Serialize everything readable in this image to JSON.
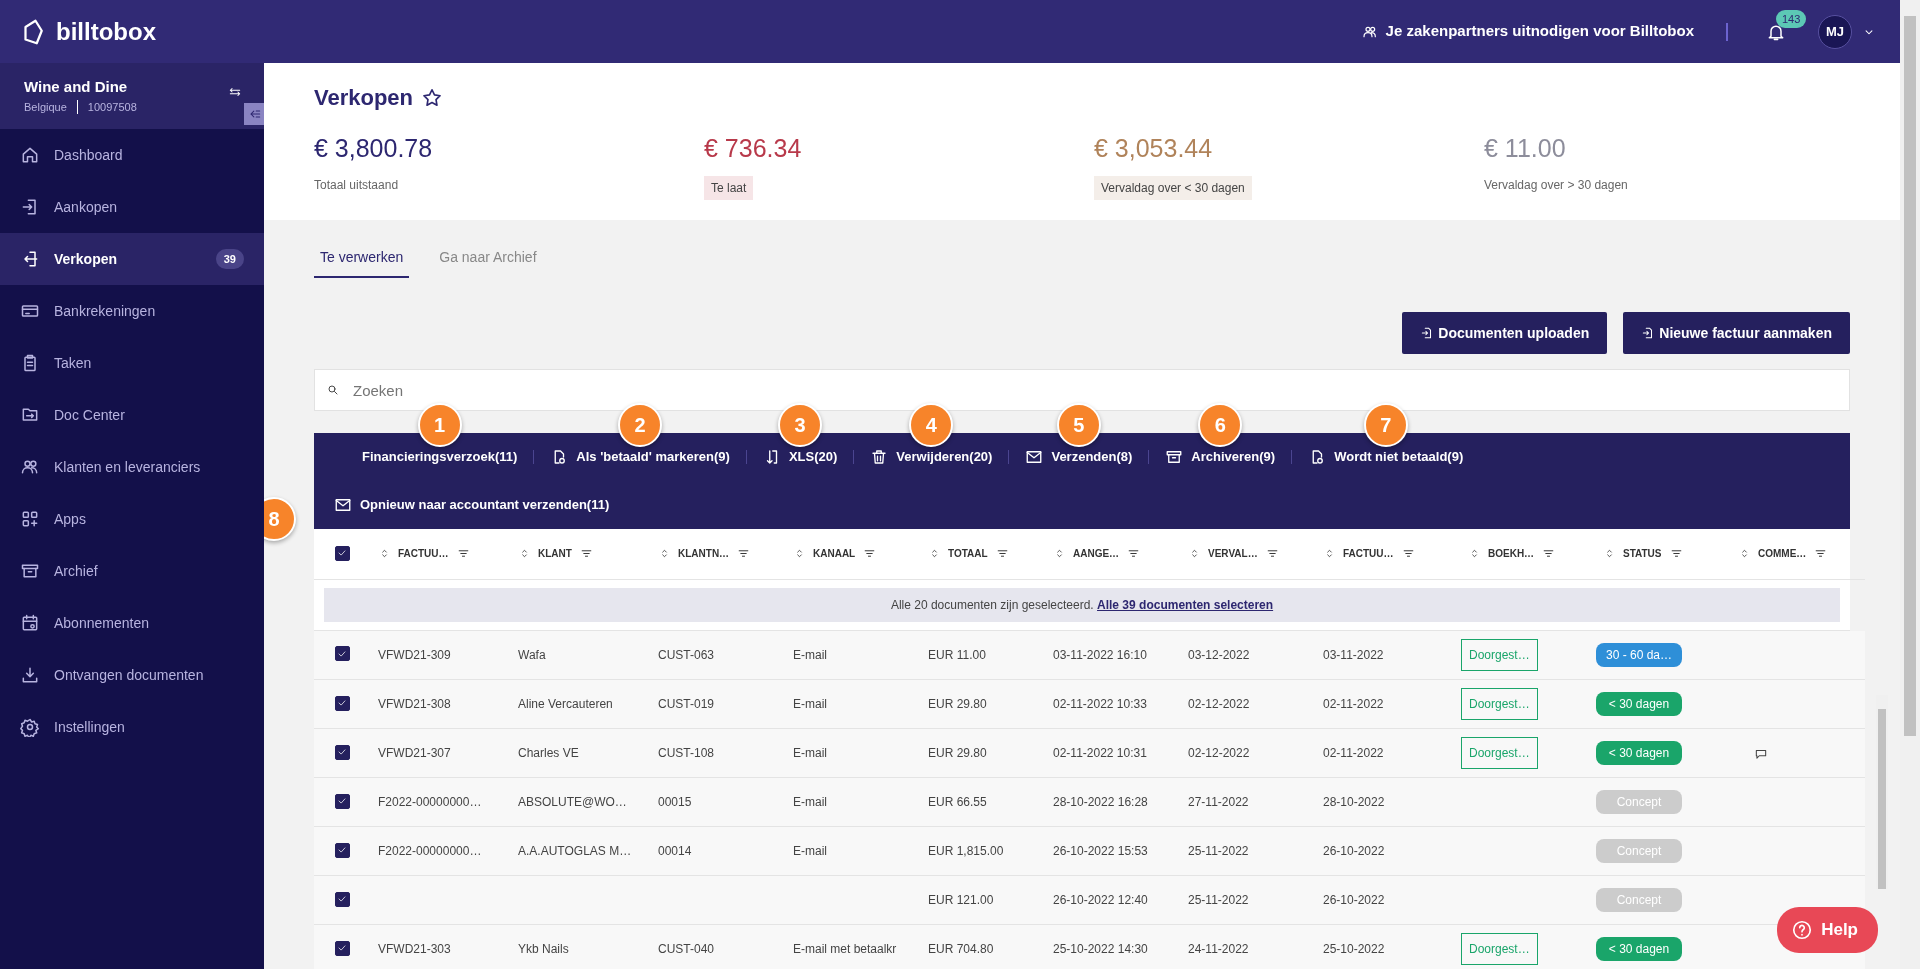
{
  "app": {
    "logo": "billtobox",
    "invite": "Je zakenpartners uitnodigen voor Billtobox",
    "notifications": "143",
    "avatar": "MJ"
  },
  "company": {
    "name": "Wine and Dine",
    "country": "Belgique",
    "number": "10097508"
  },
  "sidebar": {
    "items": [
      {
        "label": "Dashboard",
        "selected": false
      },
      {
        "label": "Aankopen",
        "selected": false
      },
      {
        "label": "Verkopen",
        "selected": true,
        "badge": "39"
      },
      {
        "label": "Bankrekeningen",
        "selected": false
      },
      {
        "label": "Taken",
        "selected": false
      },
      {
        "label": "Doc Center",
        "selected": false
      },
      {
        "label": "Klanten en leveranciers",
        "selected": false
      },
      {
        "label": "Apps",
        "selected": false
      },
      {
        "label": "Archief",
        "selected": false
      },
      {
        "label": "Abonnementen",
        "selected": false
      },
      {
        "label": "Ontvangen documenten",
        "selected": false
      },
      {
        "label": "Instellingen",
        "selected": false
      }
    ]
  },
  "page": {
    "title": "Verkopen",
    "starred": false
  },
  "summary": [
    {
      "amount": "€ 3,800.78",
      "label": "Totaal uitstaand",
      "kind": "plain",
      "color": "#2d2770"
    },
    {
      "amount": "€ 736.34",
      "label": "Te laat",
      "kind": "tag",
      "color": "#b8394a"
    },
    {
      "amount": "€ 3,053.44",
      "label": "Vervaldag over < 30 dagen",
      "kind": "tag",
      "color": "#b0835a"
    },
    {
      "amount": "€ 11.00",
      "label": "Vervaldag over > 30 dagen",
      "kind": "plain",
      "color": "#8d8d9b"
    }
  ],
  "tabs": [
    {
      "label": "Te verwerken",
      "selected": true
    },
    {
      "label": "Ga naar Archief",
      "selected": false
    }
  ],
  "buttons": [
    "Documenten uploaden",
    "Nieuwe factuur aanmaken"
  ],
  "search": {
    "placeholder": "Zoeken"
  },
  "action_rows": [
    [
      {
        "label": "Financieringsverzoek(11)",
        "callout": "1"
      },
      {
        "label": "Als 'betaald' markeren(9)",
        "callout": "2"
      },
      {
        "label": "XLS(20)",
        "callout": "3"
      },
      {
        "label": "Verwijderen(20)",
        "callout": "4"
      },
      {
        "label": "Verzenden(8)",
        "callout": "5"
      },
      {
        "label": "Archiveren(9)",
        "callout": "6"
      },
      {
        "label": "Wordt niet betaald(9)",
        "callout": "7"
      }
    ],
    [
      {
        "label": "Opnieuw naar accountant verzenden(11)",
        "callout": "8"
      }
    ]
  ],
  "table": {
    "all_checked": true,
    "columns": [
      "FACTUU…",
      "KLANT",
      "KLANTN…",
      "KANAAL",
      "TOTAAL",
      "AANGE…",
      "VERVAL…",
      "FACTUU…",
      "BOEKH…",
      "STATUS",
      "COMME…"
    ],
    "selection_note": "Alle 20 documenten zijn geselecteerd.",
    "selection_link": "Alle 39 documenten selecteren",
    "rows": [
      {
        "checked": true,
        "number": "VFWD21-309",
        "client": "Wafa",
        "client_no": "CUST-063",
        "channel": "E-mail",
        "total": "EUR 11.00",
        "created": "03-11-2022 16:10",
        "due": "03-12-2022",
        "invoice_date": "03-11-2022",
        "booking": "Doorgest…",
        "status": {
          "text": "30 - 60 da…",
          "color": "#2e8fd8"
        },
        "comment": false
      },
      {
        "checked": true,
        "number": "VFWD21-308",
        "client": "Aline Vercauteren",
        "client_no": "CUST-019",
        "channel": "E-mail",
        "total": "EUR 29.80",
        "created": "02-11-2022 10:33",
        "due": "02-12-2022",
        "invoice_date": "02-11-2022",
        "booking": "Doorgest…",
        "status": {
          "text": "< 30 dagen",
          "color": "#1aa56a"
        },
        "comment": false
      },
      {
        "checked": true,
        "number": "VFWD21-307",
        "client": "Charles VE",
        "client_no": "CUST-108",
        "channel": "E-mail",
        "total": "EUR 29.80",
        "created": "02-11-2022 10:31",
        "due": "02-12-2022",
        "invoice_date": "02-11-2022",
        "booking": "Doorgest…",
        "status": {
          "text": "< 30 dagen",
          "color": "#1aa56a"
        },
        "comment": true
      },
      {
        "checked": true,
        "number": "F2022-00000000…",
        "client": "ABSOLUTE@WO…",
        "client_no": "00015",
        "channel": "E-mail",
        "total": "EUR 66.55",
        "created": "28-10-2022 16:28",
        "due": "27-11-2022",
        "invoice_date": "28-10-2022",
        "status": {
          "text": "Concept",
          "color": "#cccccc"
        },
        "comment": false
      },
      {
        "checked": true,
        "number": "F2022-00000000…",
        "client": "A.A.AUTOGLAS M…",
        "client_no": "00014",
        "channel": "E-mail",
        "total": "EUR 1,815.00",
        "created": "26-10-2022 15:53",
        "due": "25-11-2022",
        "invoice_date": "26-10-2022",
        "status": {
          "text": "Concept",
          "color": "#cccccc"
        },
        "comment": false
      },
      {
        "checked": true,
        "total": "EUR 121.00",
        "created": "26-10-2022 12:40",
        "due": "25-11-2022",
        "invoice_date": "26-10-2022",
        "status": {
          "text": "Concept",
          "color": "#cccccc"
        },
        "comment": false
      },
      {
        "checked": true,
        "number": "VFWD21-303",
        "client": "Ykb Nails",
        "client_no": "CUST-040",
        "channel": "E-mail met betaalkr",
        "total": "EUR 704.80",
        "created": "25-10-2022 14:30",
        "due": "24-11-2022",
        "invoice_date": "25-10-2022",
        "booking": "Doorgest…",
        "status": {
          "text": "< 30 dagen",
          "color": "#1aa56a"
        },
        "comment": false
      }
    ]
  },
  "help": "Help"
}
